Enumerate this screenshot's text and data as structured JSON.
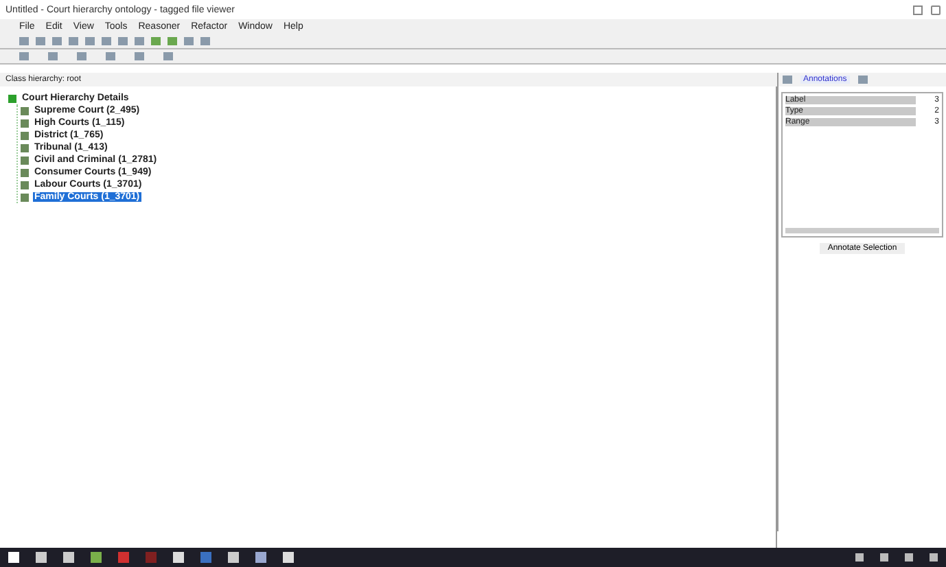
{
  "window": {
    "title": "Untitled - Court hierarchy ontology - tagged file viewer"
  },
  "menu": [
    "File",
    "Edit",
    "View",
    "Tools",
    "Reasoner",
    "Refactor",
    "Window",
    "Help"
  ],
  "breadcrumb": "Class hierarchy: root",
  "tree": {
    "label": "Court Hierarchy Details",
    "expanded": true,
    "children": [
      {
        "label": "Supreme Court (2_495)",
        "selected": false
      },
      {
        "label": "High Courts (1_115)",
        "selected": false
      },
      {
        "label": "District (1_765)",
        "selected": false
      },
      {
        "label": "Tribunal (1_413)",
        "selected": false
      },
      {
        "label": "Civil and Criminal (1_2781)",
        "selected": false
      },
      {
        "label": "Consumer Courts (1_949)",
        "selected": false
      },
      {
        "label": "Labour Courts (1_3701)",
        "selected": false
      },
      {
        "label": "Family Courts (1_3701)",
        "selected": true
      }
    ]
  },
  "side_panel": {
    "tab": "Annotations",
    "rows": [
      {
        "name": "Label",
        "value": "3"
      },
      {
        "name": "Type",
        "value": "2"
      },
      {
        "name": "Range",
        "value": "3"
      }
    ],
    "button": "Annotate Selection"
  }
}
